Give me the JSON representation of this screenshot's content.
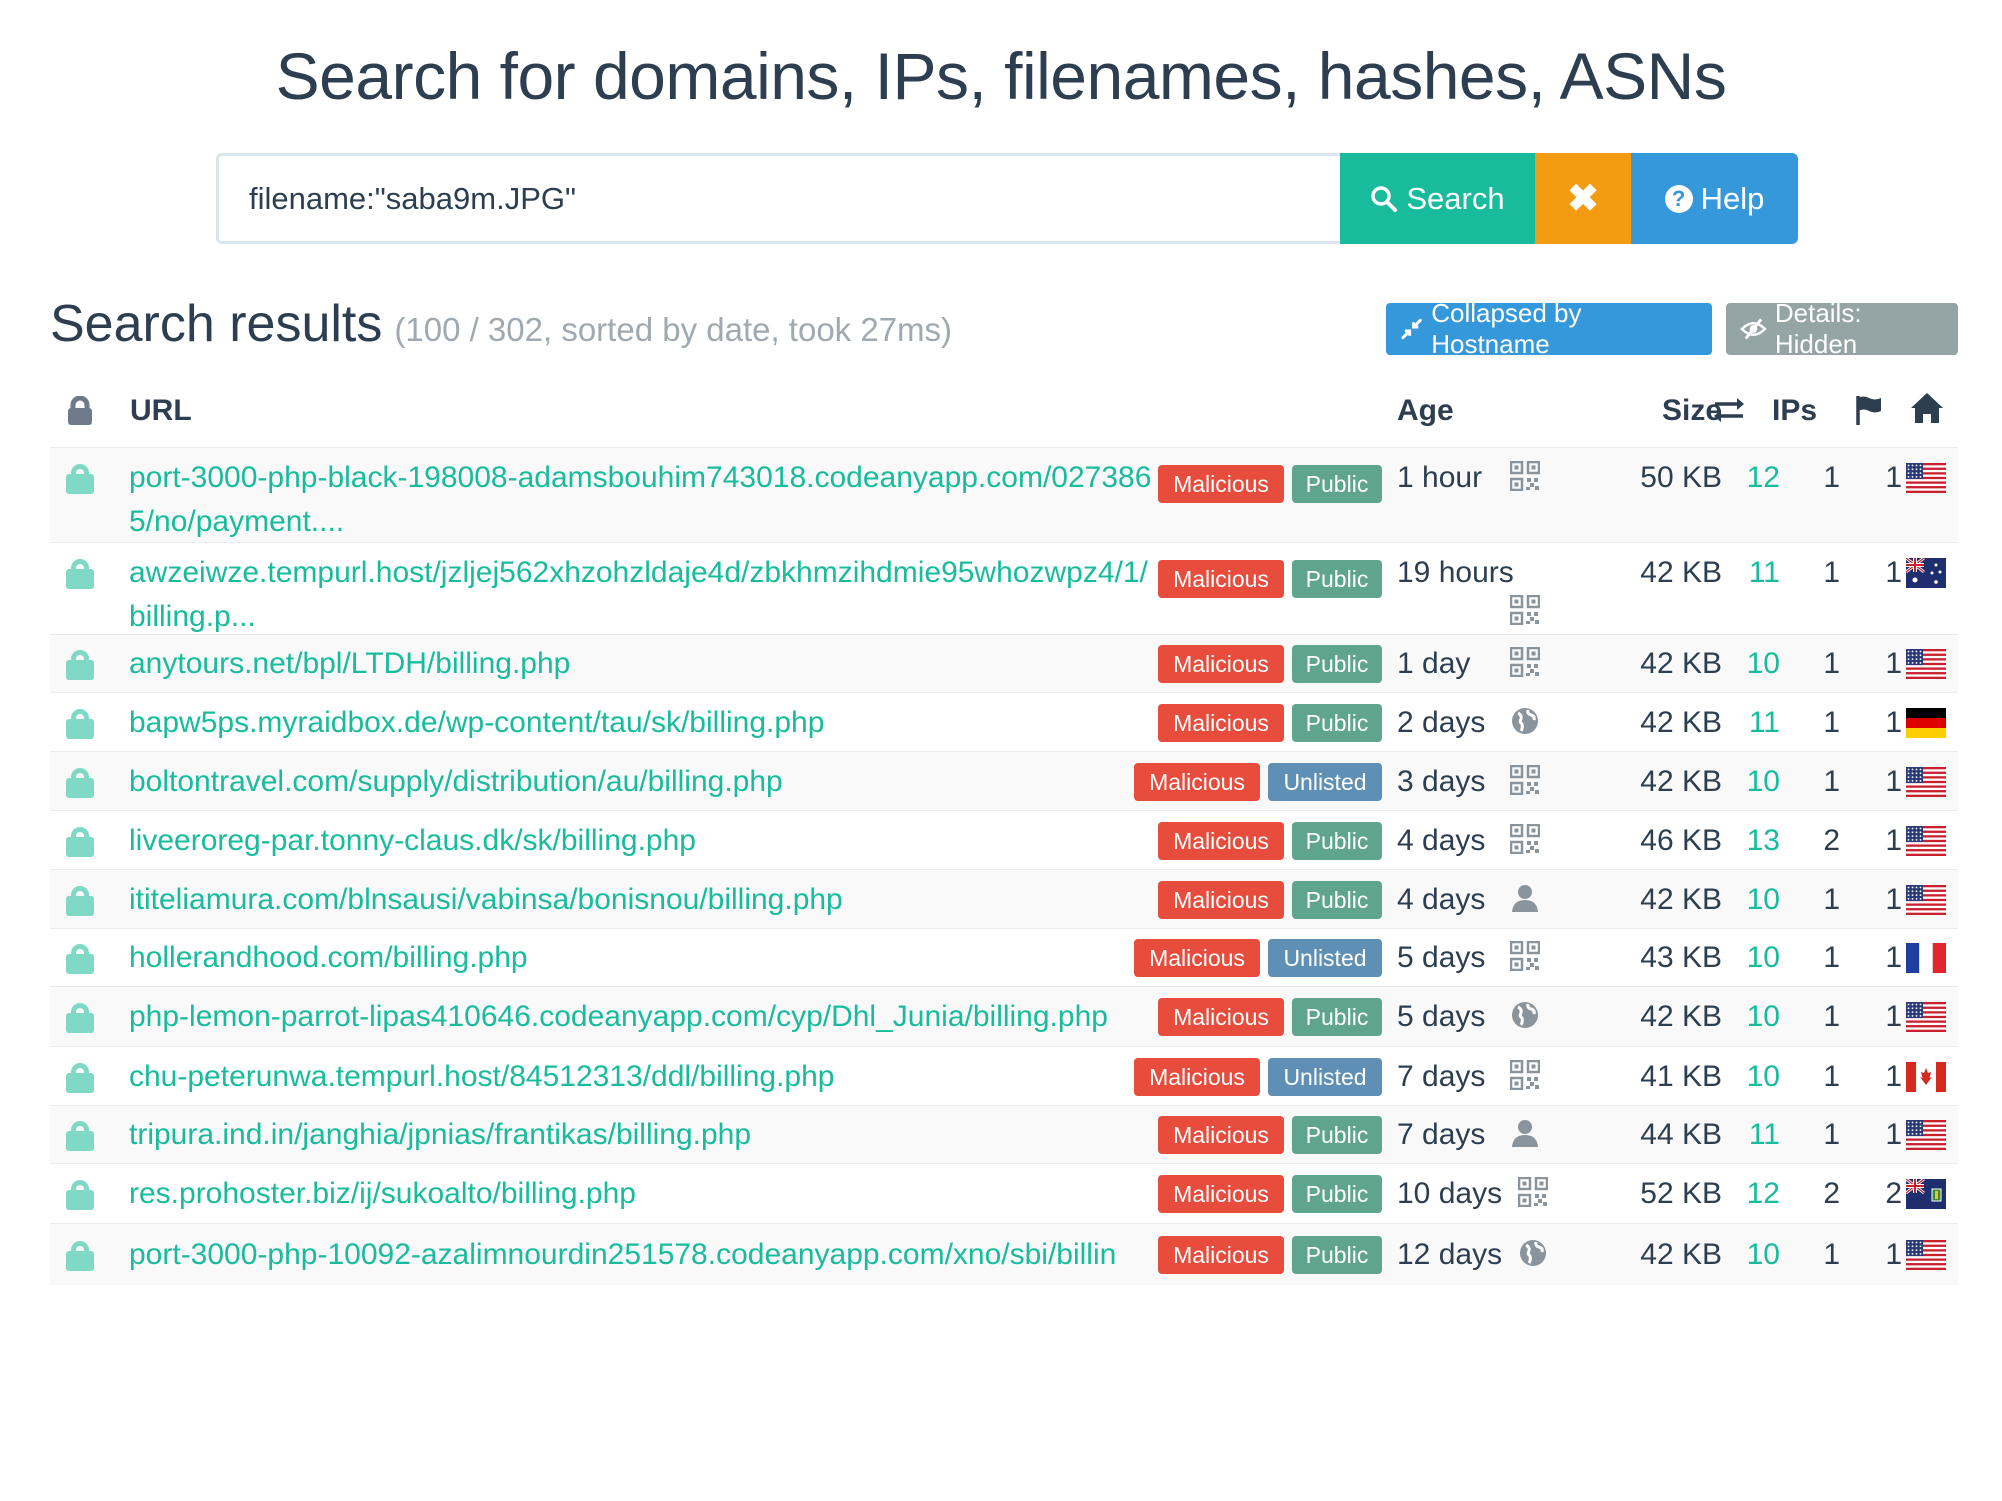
{
  "header": {
    "title": "Search for domains, IPs, filenames, hashes, ASNs"
  },
  "search": {
    "value": "filename:\"saba9m.JPG\"",
    "search_label": "Search",
    "clear_label": "✖",
    "help_label": "Help"
  },
  "results": {
    "title": "Search results",
    "meta": "(100 / 302, sorted by date, took 27ms)",
    "collapsed_label": "Collapsed by Hostname",
    "details_label": "Details: Hidden"
  },
  "columns": {
    "url": "URL",
    "age": "Age",
    "size": "Size",
    "ips": "IPs"
  },
  "colors": {
    "accent": "#18bc9c",
    "malicious": "#e74c3c",
    "public": "#5fa58e",
    "unlisted": "#5f8fb4",
    "clear": "#f39c12",
    "help": "#3498db",
    "title": "#2c3e50"
  },
  "rows": [
    {
      "url": "port-3000-php-black-198008-adamsbouhim743018.codeanyapp.com/0273865/no/payment....",
      "verdict": "Malicious",
      "visibility": "Public",
      "age": "1 hour",
      "source_icon": "qr-code-icon",
      "size": "50 KB",
      "transfers": "12",
      "ips": "1",
      "asns": "1",
      "country": "us",
      "country_icon": "flag-us-icon"
    },
    {
      "url": "awzeiwze.tempurl.host/jzljej562xhzohzldaje4d/zbkhmzihdmie95whozwpz4/1/billing.p...",
      "verdict": "Malicious",
      "visibility": "Public",
      "age": "19 hours",
      "source_icon": "qr-code-icon",
      "size": "42 KB",
      "transfers": "11",
      "ips": "1",
      "asns": "1",
      "country": "au",
      "country_icon": "flag-au-icon"
    },
    {
      "url": "anytours.net/bpl/LTDH/billing.php",
      "verdict": "Malicious",
      "visibility": "Public",
      "age": "1 day",
      "source_icon": "qr-code-icon",
      "size": "42 KB",
      "transfers": "10",
      "ips": "1",
      "asns": "1",
      "country": "us",
      "country_icon": "flag-us-icon"
    },
    {
      "url": "bapw5ps.myraidbox.de/wp-content/tau/sk/billing.php",
      "verdict": "Malicious",
      "visibility": "Public",
      "age": "2 days",
      "source_icon": "globe-icon",
      "size": "42 KB",
      "transfers": "11",
      "ips": "1",
      "asns": "1",
      "country": "de",
      "country_icon": "flag-de-icon"
    },
    {
      "url": "boltontravel.com/supply/distribution/au/billing.php",
      "verdict": "Malicious",
      "visibility": "Unlisted",
      "age": "3 days",
      "source_icon": "qr-code-icon",
      "size": "42 KB",
      "transfers": "10",
      "ips": "1",
      "asns": "1",
      "country": "us",
      "country_icon": "flag-us-icon"
    },
    {
      "url": "liveeroreg-par.tonny-claus.dk/sk/billing.php",
      "verdict": "Malicious",
      "visibility": "Public",
      "age": "4 days",
      "source_icon": "qr-code-icon",
      "size": "46 KB",
      "transfers": "13",
      "ips": "2",
      "asns": "1",
      "country": "us",
      "country_icon": "flag-us-icon"
    },
    {
      "url": "ititeliamura.com/blnsausi/vabinsa/bonisnou/billing.php",
      "verdict": "Malicious",
      "visibility": "Public",
      "age": "4 days",
      "source_icon": "user-icon",
      "size": "42 KB",
      "transfers": "10",
      "ips": "1",
      "asns": "1",
      "country": "us",
      "country_icon": "flag-us-icon"
    },
    {
      "url": "hollerandhood.com/billing.php",
      "verdict": "Malicious",
      "visibility": "Unlisted",
      "age": "5 days",
      "source_icon": "qr-code-icon",
      "size": "43 KB",
      "transfers": "10",
      "ips": "1",
      "asns": "1",
      "country": "fr",
      "country_icon": "flag-fr-icon"
    },
    {
      "url": "php-lemon-parrot-lipas410646.codeanyapp.com/cyp/Dhl_Junia/billing.php",
      "verdict": "Malicious",
      "visibility": "Public",
      "age": "5 days",
      "source_icon": "globe-icon",
      "size": "42 KB",
      "transfers": "10",
      "ips": "1",
      "asns": "1",
      "country": "us",
      "country_icon": "flag-us-icon"
    },
    {
      "url": "chu-peterunwa.tempurl.host/84512313/ddl/billing.php",
      "verdict": "Malicious",
      "visibility": "Unlisted",
      "age": "7 days",
      "source_icon": "qr-code-icon",
      "size": "41 KB",
      "transfers": "10",
      "ips": "1",
      "asns": "1",
      "country": "ca",
      "country_icon": "flag-ca-icon"
    },
    {
      "url": "tripura.ind.in/janghia/jpnias/frantikas/billing.php",
      "verdict": "Malicious",
      "visibility": "Public",
      "age": "7 days",
      "source_icon": "user-icon",
      "size": "44 KB",
      "transfers": "11",
      "ips": "1",
      "asns": "1",
      "country": "us",
      "country_icon": "flag-us-icon"
    },
    {
      "url": "res.prohoster.biz/ij/sukoalto/billing.php",
      "verdict": "Malicious",
      "visibility": "Public",
      "age": "10 days",
      "source_icon": "qr-code-icon",
      "size": "52 KB",
      "transfers": "12",
      "ips": "2",
      "asns": "2",
      "country": "vg",
      "country_icon": "flag-vg-icon"
    },
    {
      "url": "port-3000-php-10092-azalimnourdin251578.codeanyapp.com/xno/sbi/billin",
      "verdict": "Malicious",
      "visibility": "Public",
      "age": "12 days",
      "source_icon": "globe-icon",
      "size": "42 KB",
      "transfers": "10",
      "ips": "1",
      "asns": "1",
      "country": "us",
      "country_icon": "flag-us-icon"
    }
  ]
}
